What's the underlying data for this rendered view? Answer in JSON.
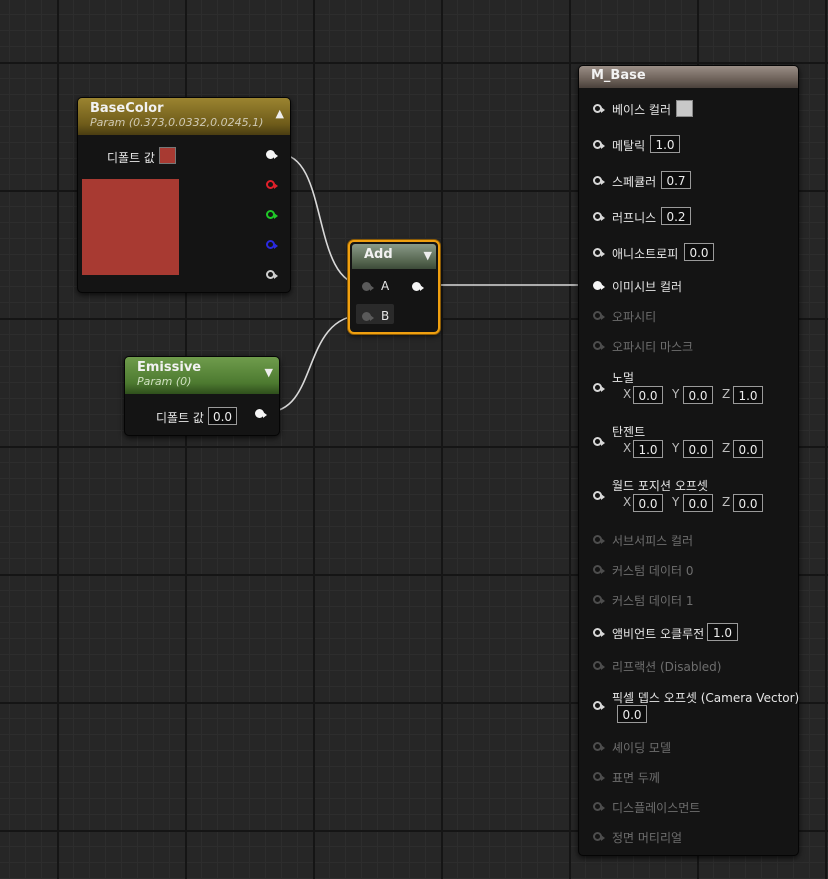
{
  "nodes": {
    "basecolor": {
      "title": "BaseColor",
      "subtitle": "Param (0.373,0.0332,0.0245,1)",
      "default_label": "디폴트 값",
      "swatch_color": "#a83a32",
      "collapse_icon": "chevron-up-icon",
      "pins": [
        "white",
        "red",
        "green",
        "blue",
        "alpha"
      ]
    },
    "emissive": {
      "title": "Emissive",
      "subtitle": "Param (0)",
      "default_label": "디폴트 값",
      "default_value": "0.0",
      "collapse_icon": "chevron-down-icon"
    },
    "add": {
      "title": "Add",
      "input_a": "A",
      "input_b": "B",
      "selection_color": "#f0a010",
      "collapse_icon": "chevron-down-icon"
    },
    "material": {
      "title": "M_Base",
      "rows": {
        "base_color": {
          "label": "베이스 컬러",
          "swatch": "#c8c8c8"
        },
        "metallic": {
          "label": "메탈릭",
          "value": "1.0"
        },
        "specular": {
          "label": "스페큘러",
          "value": "0.7"
        },
        "roughness": {
          "label": "러프니스",
          "value": "0.2"
        },
        "anisotropy": {
          "label": "애니소트로피",
          "value": "0.0"
        },
        "emissive": {
          "label": "이미시브 컬러"
        },
        "opacity": {
          "label": "오파시티"
        },
        "opacity_mask": {
          "label": "오파시티 마스크"
        },
        "normal": {
          "label": "노멀",
          "x": "0.0",
          "y": "0.0",
          "z": "1.0"
        },
        "tangent": {
          "label": "탄젠트",
          "x": "1.0",
          "y": "0.0",
          "z": "0.0"
        },
        "wpo": {
          "label": "월드 포지션 오프셋",
          "x": "0.0",
          "y": "0.0",
          "z": "0.0"
        },
        "subsurface": {
          "label": "서브서피스 컬러"
        },
        "custom0": {
          "label": "커스텀 데이터 0"
        },
        "custom1": {
          "label": "커스텀 데이터 1"
        },
        "ao": {
          "label": "앰비언트 오클루전",
          "value": "1.0"
        },
        "refraction": {
          "label": "리프랙션 (Disabled)"
        },
        "pdo": {
          "label": "픽셀 뎁스 오프셋 (Camera Vector)",
          "value": "0.0"
        },
        "shading_model": {
          "label": "셰이딩 모델"
        },
        "surface_thickness": {
          "label": "표면 두께"
        },
        "displacement": {
          "label": "디스플레이스먼트"
        },
        "front_material": {
          "label": "정면 머티리얼"
        }
      }
    }
  },
  "axis_labels": {
    "x": "X",
    "y": "Y",
    "z": "Z"
  },
  "colors": {
    "graph_bg": "#262626",
    "wire": "#d9d9d9",
    "param_vector_header": "#8a7424",
    "param_scalar_header": "#5d8b3c",
    "math_header": "#5a6a58",
    "material_header": "#6e625a"
  }
}
